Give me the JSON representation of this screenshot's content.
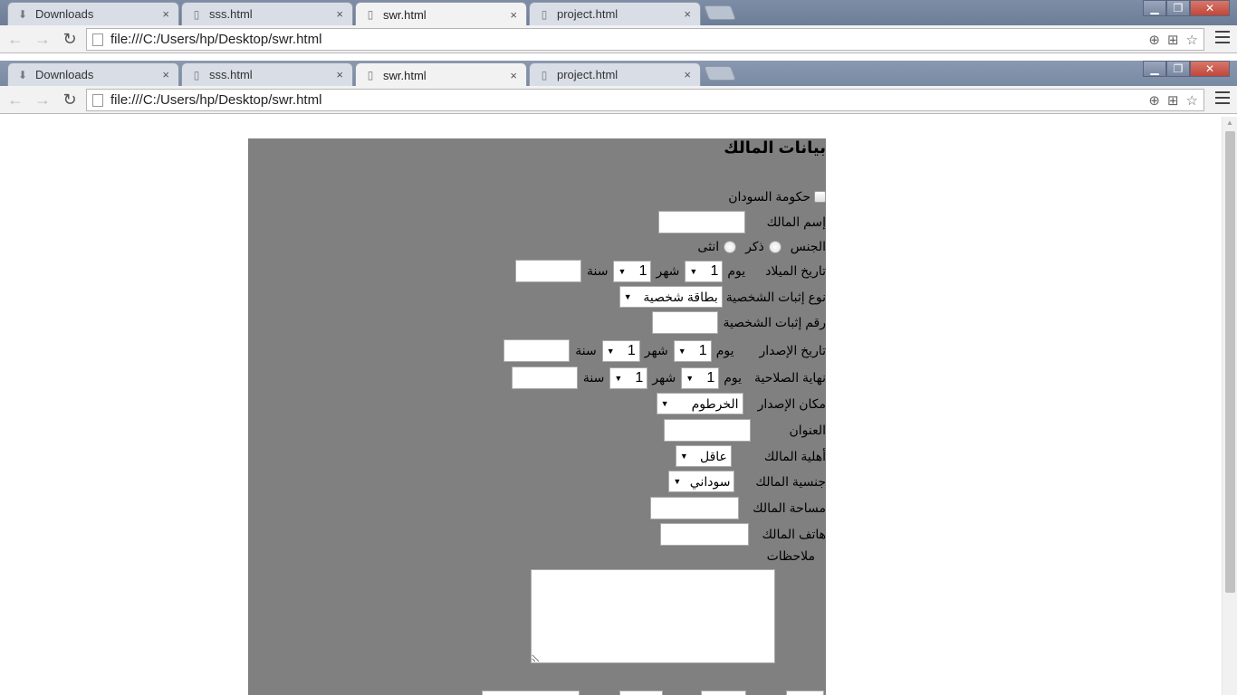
{
  "browser": {
    "tabs": [
      {
        "title": "Downloads",
        "icon": "download-icon"
      },
      {
        "title": "sss.html",
        "icon": "page-icon"
      },
      {
        "title": "swr.html",
        "icon": "page-icon",
        "active": true
      },
      {
        "title": "project.html",
        "icon": "page-icon"
      }
    ],
    "url": "file:///C:/Users/hp/Desktop/swr.html",
    "close_glyph": "×"
  },
  "form": {
    "title": "بيانات المالك",
    "government_label": "حكومة السودان",
    "owner_name_label": "إسم المالك",
    "gender_label": "الجنس",
    "male_label": "ذكر",
    "female_label": "انثى",
    "birth_date_label": "تاريخ الميلاد",
    "day_label": "يوم",
    "month_label": "شهر",
    "year_label": "سنة",
    "default_day": "1",
    "default_month": "1",
    "id_type_label": "نوع إثبات الشخصية",
    "id_type_value": "بطاقة شخصية",
    "id_number_label": "رقم إثبات الشخصية",
    "issue_date_label": "تاريخ الإصدار",
    "expiry_label": "نهاية الصلاحية",
    "issue_place_label": "مكان الإصدار",
    "issue_place_value": "الخرطوم",
    "address_label": "العنوان",
    "eligibility_label": "أهلية المالك",
    "eligibility_value": "عاقل",
    "nationality_label": "جنسية المالك",
    "nationality_value": "سوداني",
    "area_label": "مساحة المالك",
    "phone_label": "هاتف المالك",
    "notes_label": "ملاحظات"
  }
}
